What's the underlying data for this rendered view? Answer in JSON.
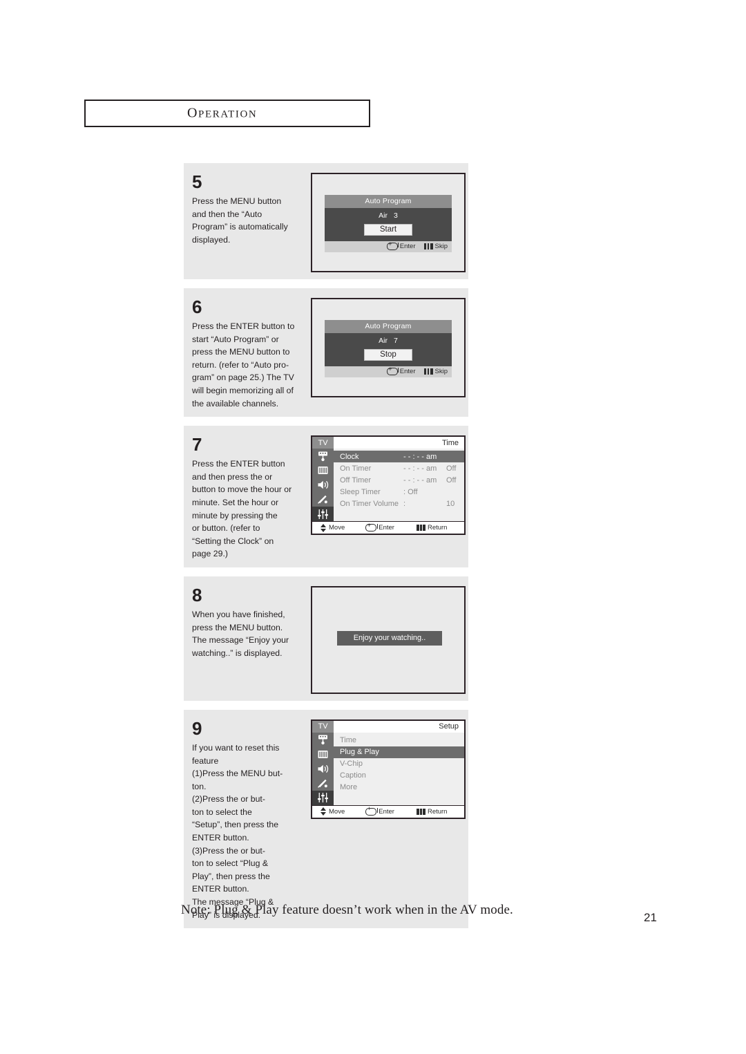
{
  "header": {
    "title_first": "O",
    "title_rest": "PERATION"
  },
  "steps": [
    {
      "number": "5",
      "text": "Press the MENU button\nand then the “Auto\nProgram” is automatically\ndisplayed.",
      "screen": {
        "kind": "auto-program",
        "title": "Auto Program",
        "air_label": "Air",
        "air_value": "3",
        "action_label": "Start",
        "foot_enter": "Enter",
        "foot_skip": "Skip"
      }
    },
    {
      "number": "6",
      "text": "Press the ENTER button to\nstart “Auto Program” or\npress the MENU button to\nreturn. (refer to “Auto pro-\ngram” on page 25.) The TV\nwill begin memorizing all of\nthe available channels.",
      "screen": {
        "kind": "auto-program",
        "title": "Auto Program",
        "air_label": "Air",
        "air_value": "7",
        "action_label": "Stop",
        "foot_enter": "Enter",
        "foot_skip": "Skip"
      }
    },
    {
      "number": "7",
      "text": "Press the ENTER button\nand then press the     or\nbutton to move the hour or\nminute.  Set the hour or\nminute by pressing the\nor     button. (refer to\n“Setting the Clock” on\npage 29.)",
      "screen": {
        "kind": "tv-menu",
        "tv_label": "TV",
        "heading": "Time",
        "active_icon_index": 4,
        "icons": [
          "input-antenna-icon",
          "picture-screen-icon",
          "sound-speaker-icon",
          "channel-dish-icon",
          "setup-sliders-icon"
        ],
        "rows": [
          {
            "label": "Clock",
            "value": "- - : - - am",
            "value2": "",
            "selected": true
          },
          {
            "label": "On Timer",
            "value": "- - : - - am",
            "value2": "Off",
            "selected": false
          },
          {
            "label": "Off Timer",
            "value": "- - : - - am",
            "value2": "Off",
            "selected": false
          },
          {
            "label": "Sleep Timer",
            "value": ": Off",
            "value2": "",
            "selected": false
          },
          {
            "label": "On Timer Volume",
            "value": ":",
            "value2": "10",
            "selected": false
          }
        ],
        "foot_move": "Move",
        "foot_enter": "Enter",
        "foot_return": "Return"
      }
    },
    {
      "number": "8",
      "text": "When you have finished,\npress the MENU button.\nThe message “Enjoy your\nwatching..” is displayed.",
      "screen": {
        "kind": "message",
        "message": "Enjoy your watching.."
      }
    },
    {
      "number": "9",
      "text": "If you want to reset this\nfeature\n(1)Press the MENU but-\n     ton.\n(2)Press the     or     but-\n     ton to select the\n     “Setup”, then press the\n     ENTER button.\n(3)Press the     or     but-\n     ton to select “Plug &\n     Play”, then press the\n     ENTER button.\n     The message “Plug &\n     Play” is displayed.",
      "screen": {
        "kind": "tv-menu",
        "tv_label": "TV",
        "heading": "Setup",
        "active_icon_index": 4,
        "icons": [
          "input-antenna-icon",
          "picture-screen-icon",
          "sound-speaker-icon",
          "channel-dish-icon",
          "setup-sliders-icon"
        ],
        "rows": [
          {
            "label": "Time",
            "value": "",
            "value2": "",
            "selected": false
          },
          {
            "label": "Plug & Play",
            "value": "",
            "value2": "",
            "selected": true
          },
          {
            "label": "V-Chip",
            "value": "",
            "value2": "",
            "selected": false
          },
          {
            "label": "Caption",
            "value": "",
            "value2": "",
            "selected": false
          },
          {
            "label": "     More",
            "value": "",
            "value2": "",
            "selected": false
          }
        ],
        "foot_move": "Move",
        "foot_enter": "Enter",
        "foot_return": "Return"
      }
    }
  ],
  "footer": {
    "note": "Note: Plug & Play feature doesn’t work when in the AV mode.",
    "page_number": "21"
  },
  "colors": {
    "ink": "#231f20",
    "panel_bg": "#e8e8e8",
    "osd_title_bg": "#8e8e8e",
    "osd_body_bg": "#4a4a4a",
    "osd_foot_bg": "#cfcfcf",
    "menu_icon_bg": "#6d6d6d",
    "menu_sel_bg": "#6d6d6d",
    "screen_bg": "#eaeaea"
  }
}
